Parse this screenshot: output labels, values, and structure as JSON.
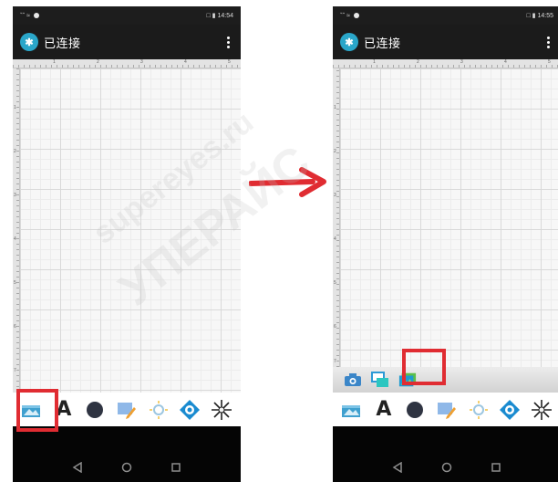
{
  "screens": [
    {
      "id": "before",
      "status_left": "‶‶ ≈",
      "status_right": "□ ▮ 14:54",
      "title": "已连接",
      "ruler_top_ticks": [
        "1",
        "2",
        "3",
        "4",
        "5"
      ],
      "ruler_left_ticks": [
        "1",
        "2",
        "3",
        "4",
        "5",
        "6",
        "7"
      ],
      "tools": [
        "insert-image",
        "text",
        "shape-circle",
        "edit-object",
        "brightness",
        "target",
        "laser"
      ],
      "text_tool_glyph": "A",
      "highlight": "insert-image-tool"
    },
    {
      "id": "after",
      "status_left": "‶‶ ≈",
      "status_right": "□ ▮ 14:55",
      "title": "已连接",
      "ruler_top_ticks": [
        "1",
        "2",
        "3",
        "4",
        "5"
      ],
      "ruler_left_ticks": [
        "1",
        "2",
        "3",
        "4",
        "5",
        "6",
        "7"
      ],
      "sub_tools": [
        "camera",
        "crop-image",
        "gallery"
      ],
      "tools": [
        "insert-image",
        "text",
        "shape-circle",
        "edit-object",
        "brightness",
        "target",
        "laser"
      ],
      "text_tool_glyph": "A",
      "highlight": "gallery-tool"
    }
  ],
  "watermark": {
    "latin": "supereyes.ru",
    "cyrillic": "УПЕРАЙС"
  },
  "colors": {
    "highlight": "#e02c32",
    "arrow": "#e02c32",
    "app_bar": "#1b1b1b",
    "nav_bar": "#050505",
    "logo": "#2aa6c9"
  }
}
